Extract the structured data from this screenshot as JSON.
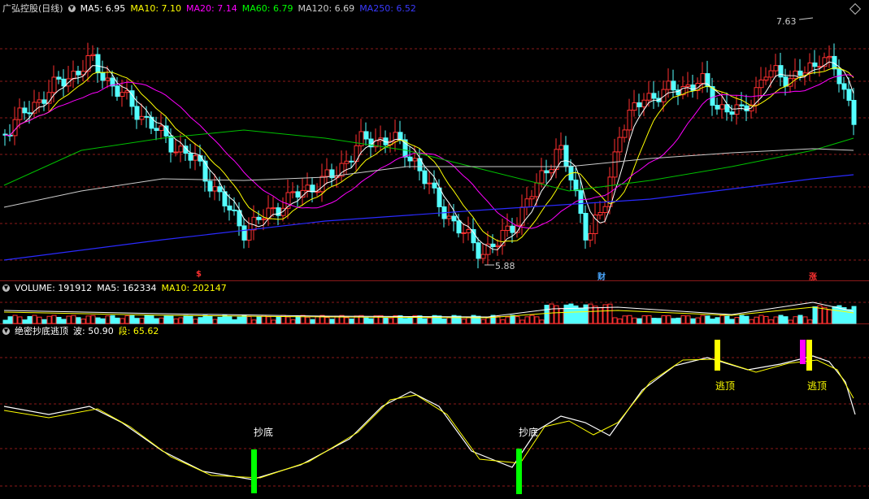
{
  "price_header": {
    "stock": "广弘控股(日线)",
    "items": [
      {
        "label": "MA5: 6.95",
        "color": "#ffffff"
      },
      {
        "label": "MA10: 7.10",
        "color": "#ffff00"
      },
      {
        "label": "MA20: 7.14",
        "color": "#ff00ff"
      },
      {
        "label": "MA60: 6.79",
        "color": "#00ff00"
      },
      {
        "label": "MA120: 6.69",
        "color": "#cccccc"
      },
      {
        "label": "MA250: 6.52",
        "color": "#3a3aff"
      }
    ]
  },
  "volume_header": {
    "items": [
      {
        "label": "VOLUME: 191912",
        "color": "#ffffff"
      },
      {
        "label": "MA5: 162334",
        "color": "#ffffff"
      },
      {
        "label": "MA10: 202147",
        "color": "#ffff00"
      }
    ]
  },
  "indicator_header": {
    "items": [
      {
        "label": "绝密抄底逃顶",
        "color": "#ffffff"
      },
      {
        "label": "波: 50.90",
        "color": "#ffffff"
      },
      {
        "label": "段: 65.62",
        "color": "#ffff00"
      }
    ]
  },
  "annotations": {
    "high": "7.63",
    "low": "5.88"
  },
  "flags": [
    {
      "label": "$",
      "color": "#ff3030"
    },
    {
      "label": "财",
      "color": "#4aa8ff"
    },
    {
      "label": "涨",
      "color": "#ff3030"
    }
  ],
  "signals": {
    "bottom": "抄底",
    "top": "逃顶"
  },
  "colors": {
    "up": "#ff3030",
    "down": "#54ffff",
    "grid": "#8b1a1a"
  }
}
